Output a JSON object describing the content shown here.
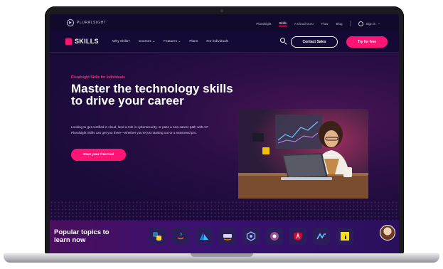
{
  "topbar": {
    "brand": "PLURALSIGHT",
    "links": [
      "Pluralsight",
      "Skills",
      "A Cloud Guru",
      "Flow",
      "Blog"
    ],
    "active_link": "Skills",
    "signin": "Sign in"
  },
  "nav": {
    "brand": "SKILLS",
    "items": [
      "Why Skills?",
      "Courses",
      "Features",
      "Plans",
      "For individuals"
    ],
    "contact_label": "Contact Sales",
    "try_label": "Try for free"
  },
  "hero": {
    "eyebrow": "Pluralsight Skills for Individuals",
    "title": "Master the technology skills to drive your career",
    "body": "Looking to get certified in cloud, land a role in cybersecurity, or pass a new career path with AI? Pluralsight Skills can get you there—whether you're just starting out or a seasoned pro.",
    "cta": "Start your free trial"
  },
  "popular": {
    "title": "Popular topics to learn now",
    "topics": [
      "python-icon",
      "java-icon",
      "azure-icon",
      "aws-icon",
      "kubernetes-icon",
      "csharp-icon",
      "angular-icon",
      "microsoft-icon",
      "javascript-icon"
    ]
  },
  "colors": {
    "accent": "#ff1675",
    "background": "#150a35",
    "topbar": "#120a2c"
  }
}
